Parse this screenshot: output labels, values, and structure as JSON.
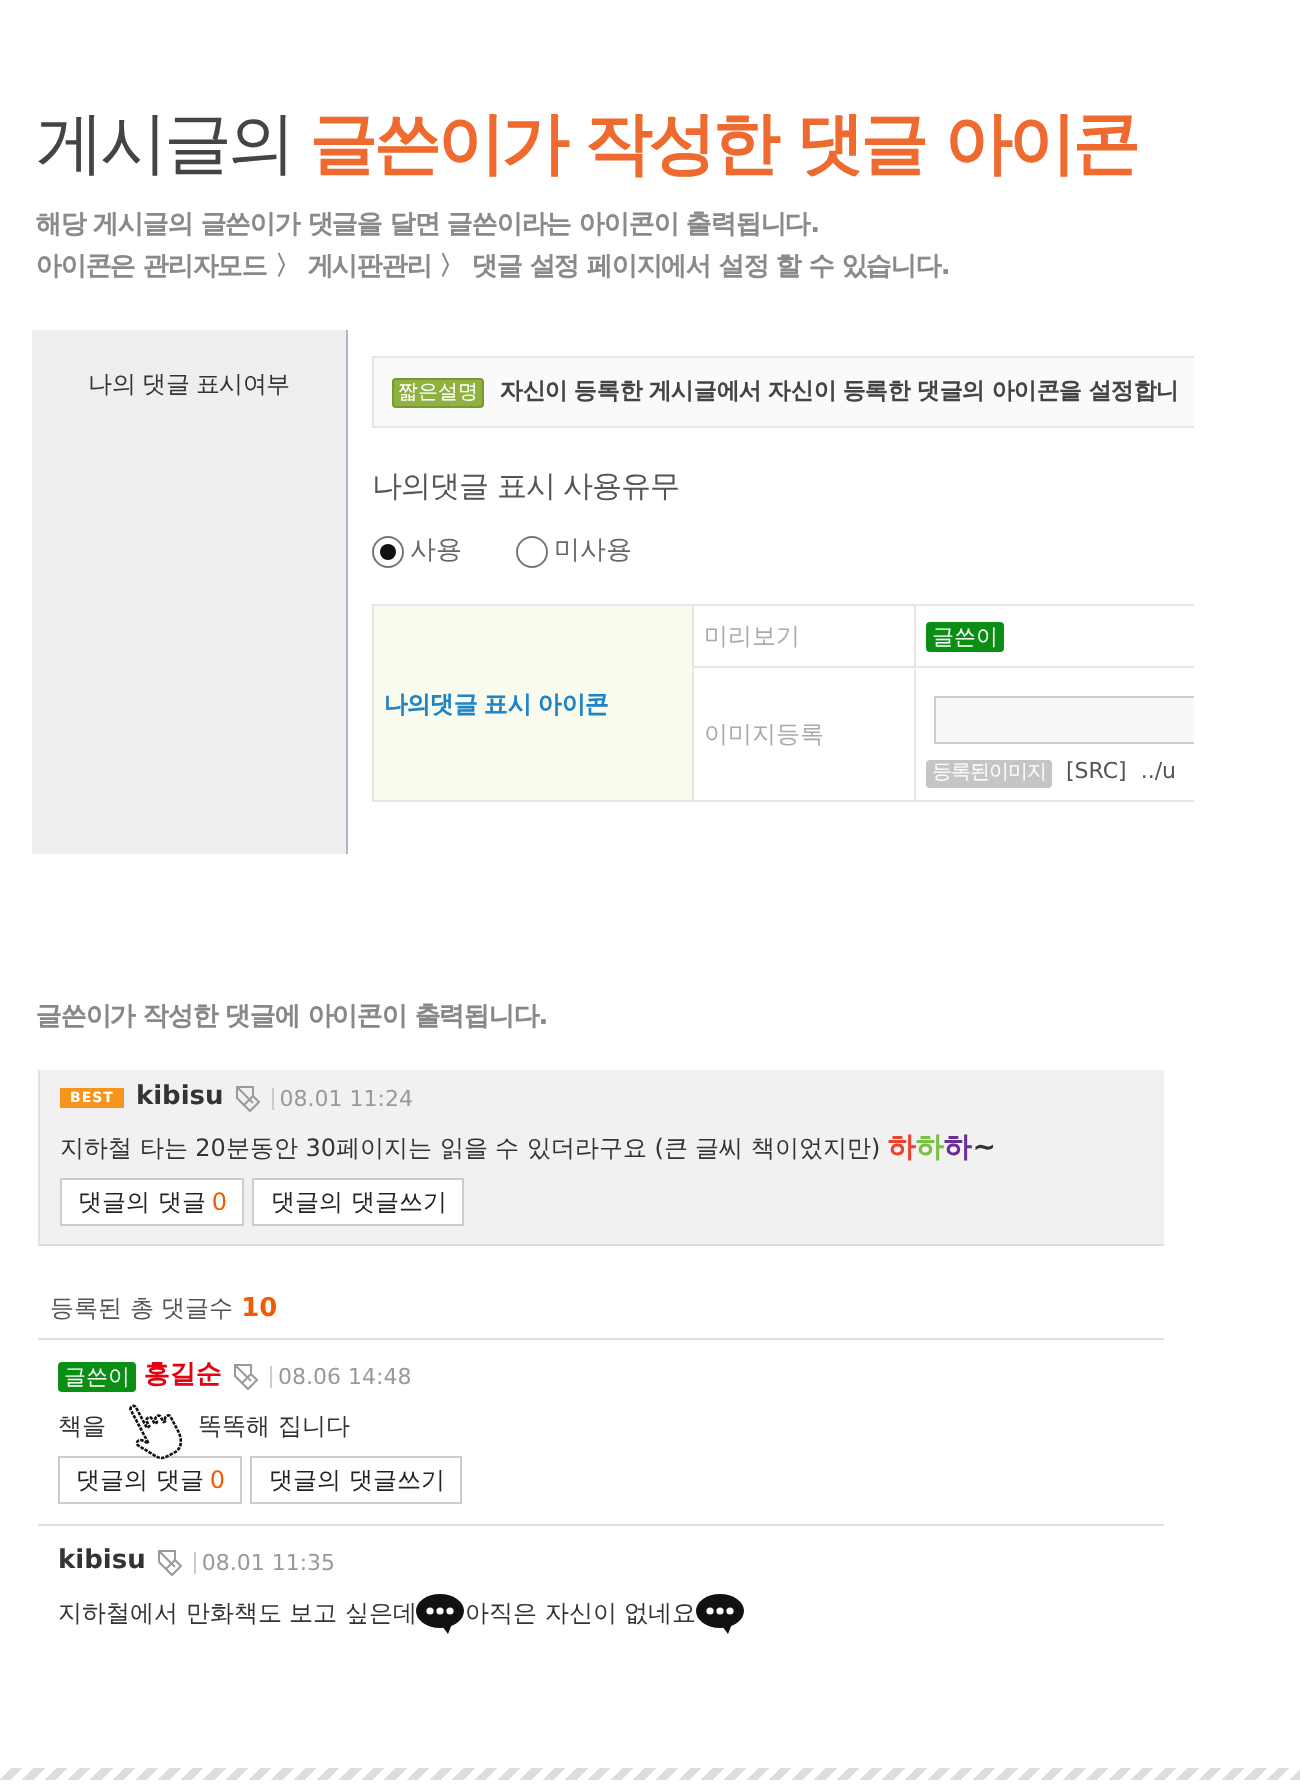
{
  "header": {
    "title": "게시글의 **글쓴이가 작성한 댓글 아이콘**",
    "description": [
      "해당 게시글의 글쓴이가 댓글을 달면 글쓴이라는 아이콘이 출력됩니다.",
      "아이콘은 관리자모드 〉 게시판관리 〉 댓글 설정 페이지에서 설정 할 수 있습니다."
    ]
  },
  "admin_panel": {
    "side_label": "나의 댓글 표시여부",
    "info": {
      "badge": "짧은설명",
      "text": "자신이 등록한 게시글에서 자신이 등록한 댓글의 아이콘을 설정합니"
    },
    "option_title": "나의댓글 표시 사용유무",
    "radios": [
      {
        "label": "사용",
        "selected": true
      },
      {
        "label": "미사용",
        "selected": false
      }
    ],
    "icon_table": {
      "row_header": "나의댓글 표시 아이콘",
      "rows": [
        {
          "kind": "preview",
          "label": "미리보기",
          "badge": "글쓴이"
        },
        {
          "kind": "upload",
          "label": "이미지등록",
          "registered_badge": "등록된이미지",
          "src_label": "[SRC]",
          "src_value": "../u"
        }
      ]
    }
  },
  "comments_section": {
    "heading": "글쓴이가 작성한 댓글에 아이콘이 출력됩니다.",
    "best_comment": {
      "badge": {
        "kind": "best",
        "text": "BEST"
      },
      "author": "kibisu",
      "highlighted": false,
      "time": "08.01 11:24",
      "body": [
        {
          "kind": "text",
          "text": "지하철 타는 20분동안 30페이지는 읽을 수 있더라구요 (큰 글씨 책이었지만)"
        },
        {
          "kind": "emoticon",
          "letters": [
            {
              "text": "하",
              "color": "#e8432d"
            },
            {
              "text": "하",
              "color": "#79c142"
            },
            {
              "text": "하",
              "color": "#6a2f93"
            },
            {
              "text": "~",
              "color": "#333333"
            }
          ]
        }
      ],
      "buttons": [
        {
          "label": "댓글의 댓글",
          "count": "0"
        },
        {
          "label": "댓글의 댓글쓰기"
        }
      ]
    },
    "total": {
      "label": "등록된 총 댓글수",
      "count": "10"
    },
    "comments": [
      {
        "badge": {
          "kind": "writer",
          "text": "글쓴이"
        },
        "author": "홍길순",
        "highlighted": true,
        "time": "08.06 14:48",
        "body": [
          {
            "kind": "text",
            "text": "책을"
          },
          {
            "kind": "cursor"
          },
          {
            "kind": "text",
            "text": "똑똑해 집니다"
          }
        ],
        "buttons": [
          {
            "label": "댓글의 댓글",
            "count": "0"
          },
          {
            "label": "댓글의 댓글쓰기"
          }
        ]
      },
      {
        "author": "kibisu",
        "highlighted": false,
        "time": "08.01 11:35",
        "body": [
          {
            "kind": "text",
            "text": "지하철에서 만화책도 보고 싶은데"
          },
          {
            "kind": "bubble"
          },
          {
            "kind": "text",
            "text": "아직은 자신이 없네요"
          },
          {
            "kind": "bubble"
          }
        ]
      }
    ]
  }
}
